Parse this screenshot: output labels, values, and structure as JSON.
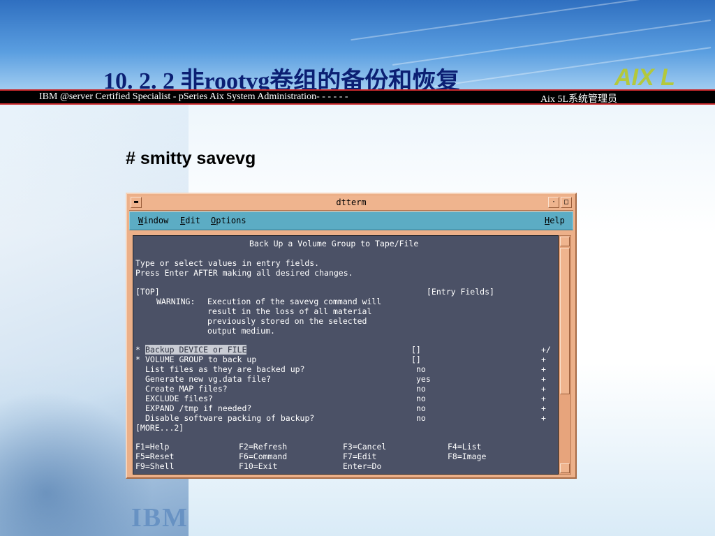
{
  "slide": {
    "title": "10. 2. 2   非rootvg卷组的备份和恢复",
    "banner_left": "IBM @server Certified Specialist - pSeries Aix System Administration- - - - - -",
    "banner_right": "Aix 5L系统管理员",
    "command": "# smitty savevg",
    "logo_text": "AIX L",
    "watermark_text": "IBM"
  },
  "window": {
    "title": "dtterm",
    "menu": {
      "window": {
        "key": "W",
        "rest": "indow"
      },
      "edit": {
        "key": "E",
        "rest": "dit"
      },
      "options": {
        "key": "O",
        "rest": "ptions"
      },
      "help": {
        "key": "H",
        "rest": "elp"
      }
    }
  },
  "screen": {
    "heading": "Back Up a Volume Group to Tape/File",
    "instructions": [
      "Type or select values in entry fields.",
      "Press Enter AFTER making all desired changes."
    ],
    "top_marker": "[TOP]",
    "entry_fields_label": "[Entry Fields]",
    "warning_label": "WARNING:",
    "warning_lines": [
      "Execution of the savevg command will",
      "result in the loss of all material",
      "previously stored on the selected",
      "output medium."
    ],
    "fields": [
      {
        "marker": "*",
        "label": "Backup DEVICE or FILE",
        "value": "[]",
        "flag": "+/",
        "selected": true
      },
      {
        "marker": "*",
        "label": "VOLUME GROUP to back up",
        "value": "[]",
        "flag": "+"
      },
      {
        "marker": "",
        "label": "List files as they are backed up?",
        "value": "no",
        "flag": "+"
      },
      {
        "marker": "",
        "label": "Generate new vg.data file?",
        "value": "yes",
        "flag": "+"
      },
      {
        "marker": "",
        "label": "Create MAP files?",
        "value": "no",
        "flag": "+"
      },
      {
        "marker": "",
        "label": "EXCLUDE files?",
        "value": "no",
        "flag": "+"
      },
      {
        "marker": "",
        "label": "EXPAND /tmp if needed?",
        "value": "no",
        "flag": "+"
      },
      {
        "marker": "",
        "label": "Disable software packing of backup?",
        "value": "no",
        "flag": "+"
      }
    ],
    "more_marker": "[MORE...2]",
    "function_keys": [
      [
        "F1=Help",
        "F2=Refresh",
        "F3=Cancel",
        "F4=List"
      ],
      [
        "F5=Reset",
        "F6=Command",
        "F7=Edit",
        "F8=Image"
      ],
      [
        "F9=Shell",
        "F10=Exit",
        "Enter=Do",
        ""
      ]
    ]
  }
}
